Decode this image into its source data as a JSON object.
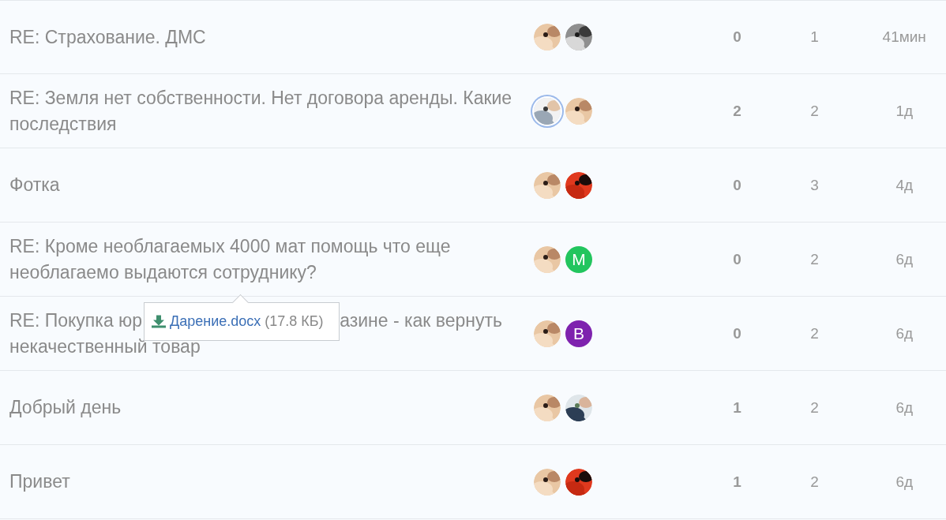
{
  "topics": [
    {
      "title": [
        "RE: Страхование. ДМС"
      ],
      "avatars": [
        {
          "kind": "picture",
          "ring": false
        },
        {
          "kind": "picture",
          "ring": false
        }
      ],
      "unread": "0",
      "replies": "1",
      "age": "41мин"
    },
    {
      "title": [
        "RE: Земля нет собственности. Нет договора аренды. Какие последствия"
      ],
      "avatars": [
        {
          "kind": "picture",
          "ring": true
        },
        {
          "kind": "picture",
          "ring": false
        }
      ],
      "unread": "2",
      "replies": "2",
      "age": "1д"
    },
    {
      "title": [
        "Фотка"
      ],
      "avatars": [
        {
          "kind": "picture",
          "ring": false
        },
        {
          "kind": "picture",
          "ring": false
        }
      ],
      "unread": "0",
      "replies": "3",
      "age": "4д"
    },
    {
      "title": [
        "RE: Кроме необлагаемых 4000 мат помощь что еще необлагаемо выдаются сотруднику?"
      ],
      "avatars": [
        {
          "kind": "picture",
          "ring": false
        },
        {
          "kind": "letter",
          "letter": "M",
          "color": "#22c55e",
          "ring": false
        }
      ],
      "unread": "0",
      "replies": "2",
      "age": "6д"
    },
    {
      "title": [
        "RE: Покупка юр",
        "азине - как вернуть",
        "некачественный товар"
      ],
      "avatars": [
        {
          "kind": "picture",
          "ring": false
        },
        {
          "kind": "letter",
          "letter": "B",
          "color": "#7e22ae",
          "ring": false
        }
      ],
      "unread": "0",
      "replies": "2",
      "age": "6д"
    },
    {
      "title": [
        "Добрый день"
      ],
      "avatars": [
        {
          "kind": "picture",
          "ring": false
        },
        {
          "kind": "picture",
          "ring": false
        }
      ],
      "unread": "1",
      "replies": "2",
      "age": "6д"
    },
    {
      "title": [
        "Привет"
      ],
      "avatars": [
        {
          "kind": "picture",
          "ring": false
        },
        {
          "kind": "picture",
          "ring": false
        }
      ],
      "unread": "1",
      "replies": "2",
      "age": "6д"
    }
  ],
  "attachment": {
    "name": "Дарение.docx",
    "size": "(17.8 КБ)"
  }
}
